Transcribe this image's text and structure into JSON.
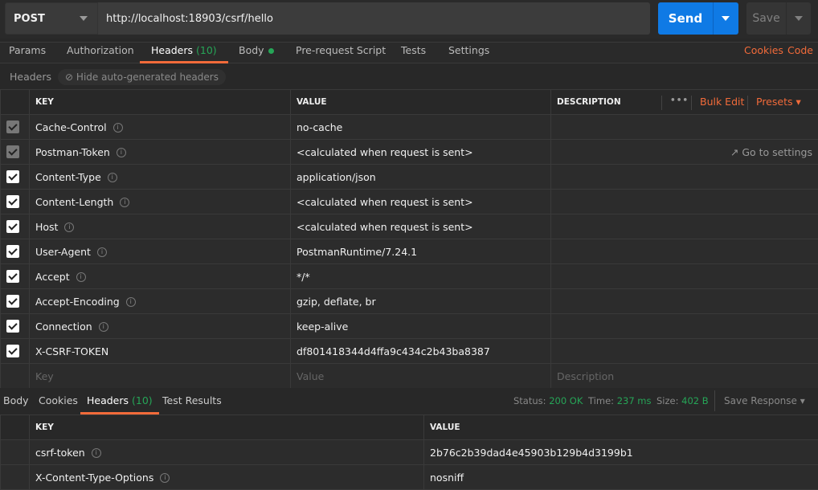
{
  "request": {
    "method": "POST",
    "url": "http://localhost:18903/csrf/hello",
    "send_label": "Send",
    "save_label": "Save"
  },
  "tabs": [
    {
      "label": "Params"
    },
    {
      "label": "Authorization"
    },
    {
      "label": "Headers",
      "count": "(10)"
    },
    {
      "label": "Body"
    },
    {
      "label": "Pre-request Script"
    },
    {
      "label": "Tests"
    },
    {
      "label": "Settings"
    }
  ],
  "links": {
    "cookies": "Cookies",
    "code": "Code"
  },
  "headers_bar": {
    "title": "Headers",
    "toggle": "Hide auto-generated headers"
  },
  "table": {
    "key": "KEY",
    "value": "VALUE",
    "description": "DESCRIPTION",
    "more": "•••",
    "bulk_edit": "Bulk Edit",
    "presets": "Presets",
    "goto_settings": "Go to settings",
    "rows": [
      {
        "key": "Cache-Control",
        "value": "no-cache",
        "disabled": true
      },
      {
        "key": "Postman-Token",
        "value": "<calculated when request is sent>",
        "disabled": true
      },
      {
        "key": "Content-Type",
        "value": "application/json"
      },
      {
        "key": "Content-Length",
        "value": "<calculated when request is sent>"
      },
      {
        "key": "Host",
        "value": "<calculated when request is sent>"
      },
      {
        "key": "User-Agent",
        "value": "PostmanRuntime/7.24.1"
      },
      {
        "key": "Accept",
        "value": "*/*"
      },
      {
        "key": "Accept-Encoding",
        "value": "gzip, deflate, br"
      },
      {
        "key": "Connection",
        "value": "keep-alive"
      },
      {
        "key": "X-CSRF-TOKEN",
        "value": "df801418344d4ffa9c434c2b43ba8387",
        "noinfo": true
      }
    ],
    "placeholders": {
      "key": "Key",
      "value": "Value",
      "description": "Description"
    }
  },
  "response": {
    "tabs": [
      "Body",
      "Cookies",
      "Headers",
      "Test Results"
    ],
    "headers_count": "(10)",
    "status_label": "Status:",
    "status": "200 OK",
    "time_label": "Time:",
    "time": "237 ms",
    "size_label": "Size:",
    "size": "402 B",
    "save_response": "Save Response",
    "key": "KEY",
    "value": "VALUE",
    "rows": [
      {
        "key": "csrf-token",
        "value": "2b76c2b39dad4e45903b129b4d3199b1"
      },
      {
        "key": "X-Content-Type-Options",
        "value": "nosniff"
      }
    ]
  },
  "colors": {
    "accent": "#f26b3a",
    "send": "#0f7ae5",
    "success": "#26a557"
  }
}
